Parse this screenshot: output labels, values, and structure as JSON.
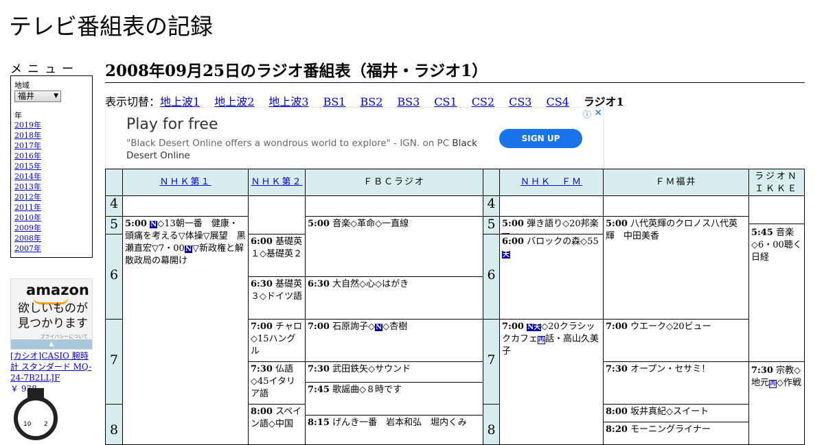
{
  "site": {
    "title": "テレビ番組表の記録"
  },
  "menu": {
    "title": "メニュー",
    "region_label": "地域",
    "region_value": "福井",
    "year_label": "年",
    "years": [
      "2019年",
      "2018年",
      "2017年",
      "2016年",
      "2015年",
      "2014年",
      "2013年",
      "2012年",
      "2011年",
      "2010年",
      "2009年",
      "2008年",
      "2007年"
    ]
  },
  "amazon_ad": {
    "logo": "amazon",
    "tagline_1": "欲しいものが",
    "tagline_2": "見つかります",
    "privacy": "プライバシーについて",
    "product": "[カシオ]CASIO 腕時計 スタンダード MQ-24-7B2LLJF",
    "price": "￥ 938"
  },
  "page": {
    "heading": "2008年09月25日のラジオ番組表（福井・ラジオ1）",
    "switch_label": "表示切替：",
    "tabs": [
      "地上波1",
      "地上波2",
      "地上波3",
      "BS1",
      "BS2",
      "BS3",
      "CS1",
      "CS2",
      "CS3",
      "CS4"
    ],
    "current_tab": "ラジオ1"
  },
  "ad": {
    "headline": "Play for free",
    "body": "\"Black Desert Online offers a wondrous world to explore\" - IGN. on PC ",
    "brand": "Black Desert Online",
    "cta": "SIGN UP",
    "info_icon": "ⓘ",
    "close_icon": "✕"
  },
  "schedule": {
    "channels": [
      "ＮＨＫ第１",
      "ＮＨＫ第２",
      "ＦＢＣラジオ",
      "ＮＨＫ　ＦＭ",
      "ＦＭ福井",
      "ラジオＮＩＫＫＥＩ"
    ],
    "hours_left": [
      "4",
      "5",
      "6",
      "7",
      "8"
    ],
    "hours_right": [
      "4",
      "5",
      "6",
      "7",
      "8"
    ],
    "programs": {
      "nhk1_0500_time": "5:00",
      "nhk1_0500_a": "◇13朝一番　健康・頭痛を考える▽体操▽展望　黒瀬直宏▽7・00",
      "nhk1_0500_b": "▽新政権と解散政局の幕開け",
      "nhk2_0600_time": "6:00",
      "nhk2_0600": "基礎英１◇基礎英２",
      "nhk2_0630_time": "6:30",
      "nhk2_0630": "基礎英３◇ドイツ語",
      "nhk2_0700_time": "7:00",
      "nhk2_0700": "チャロ◇15ハングル",
      "nhk2_0730_time": "7:30",
      "nhk2_0730": "仏語◇45イタリア語",
      "nhk2_0800_time": "8:00",
      "nhk2_0800": "スペイン語◇中国",
      "fbc_0500_time": "5:00",
      "fbc_0500": "音楽◇革命◇一直線",
      "fbc_0630_time": "6:30",
      "fbc_0630": "大自然◇心◇はがき",
      "fbc_0700_time": "7:00",
      "fbc_0700_a": "石原詢子◇",
      "fbc_0700_b": "◇杏樹",
      "fbc_0730_time": "7:30",
      "fbc_0730": "武田鉄矢◇サウンド",
      "fbc_0745_time": "7:45",
      "fbc_0745": "歌謡曲◇８時です",
      "fbc_0815_time": "8:15",
      "fbc_0815": "げんき一番　岩本和弘　堀内くみ",
      "fm_0500_time": "5:00",
      "fm_0500": "弾き語り◇20邦楽",
      "fm_0600_time": "6:00",
      "fm_0600": "バロックの森◇55",
      "fm_0700_time": "7:00",
      "fm_0700_a": "◇20クラシックカフェ",
      "fm_0700_b": "話・高山久美子",
      "fmf_0500_time": "5:00",
      "fmf_0500": "八代英輝のクロノス八代英輝　中田美香",
      "fmf_0700_time": "7:00",
      "fmf_0700": "ウエーク◇20ビュー",
      "fmf_0730_time": "7:30",
      "fmf_0730": "オープン・セサミ！",
      "fmf_0800_time": "8:00",
      "fmf_0800": "坂井真紀◇スイート",
      "fmf_0820_time": "8:20",
      "fmf_0820": "モーニングライナー",
      "nikkei_0545_time": "5:45",
      "nikkei_0545": "音楽◇6・00聴く日経",
      "nikkei_0730_time": "7:30",
      "nikkei_0730_a": "宗教◇地元",
      "nikkei_0730_b": "◇作戦"
    },
    "badges": {
      "news": "N",
      "news_weather": "N天",
      "weather": "天",
      "rerun": "再"
    }
  }
}
